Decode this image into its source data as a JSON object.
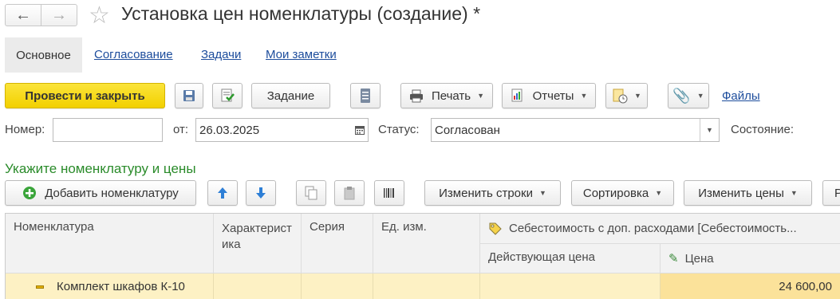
{
  "title": "Установка цен номенклатуры (создание) *",
  "tabs": [
    "Основное",
    "Согласование",
    "Задачи",
    "Мои заметки"
  ],
  "toolbar": {
    "post_close": "Провести и закрыть",
    "task": "Задание",
    "print": "Печать",
    "reports": "Отчеты",
    "files": "Файлы"
  },
  "fields": {
    "number_label": "Номер:",
    "number_value": "",
    "date_label": "от:",
    "date_value": "26.03.2025",
    "status_label": "Статус:",
    "status_value": "Согласован",
    "state_label": "Состояние:"
  },
  "section_title": "Укажите номенклатуру и цены",
  "table_toolbar": {
    "add": "Добавить номенклатуру",
    "change_rows": "Изменить строки",
    "sort": "Сортировка",
    "change_prices": "Изменить цены",
    "more": "Р"
  },
  "table": {
    "headers": {
      "nomenclature": "Номенклатура",
      "characteristic": "Характеристика",
      "series": "Серия",
      "unit": "Ед. изм.",
      "cost_group": "Себестоимость с доп. расходами [Себестоимость...",
      "current_price": "Действующая цена",
      "price": "Цена"
    },
    "rows": [
      {
        "nomenclature": "Комплект шкафов К-10",
        "characteristic": "",
        "series": "",
        "unit": "",
        "current_price": "",
        "price": "24 600,00"
      }
    ]
  },
  "colors": {
    "accent_yellow": "#f5d80f",
    "link": "#1c4c9c",
    "section_green": "#2a8b2a",
    "row_highlight": "#fdf1c4"
  }
}
